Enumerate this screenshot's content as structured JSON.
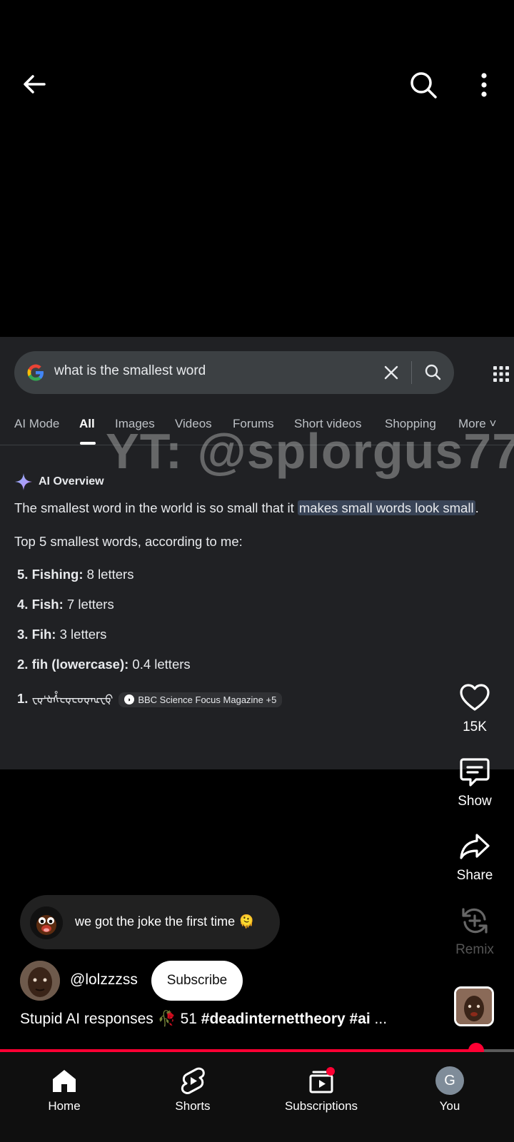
{
  "top_bar": {
    "back_icon": "arrow-left-icon",
    "search_icon": "search-icon",
    "more_icon": "more-vert-icon"
  },
  "video": {
    "google": {
      "query": "what is the smallest word",
      "tabs": [
        "AI Mode",
        "All",
        "Images",
        "Videos",
        "Forums",
        "Short videos",
        "Shopping",
        "More"
      ],
      "active_tab": "All"
    },
    "watermark": "YT: @splorgus77",
    "ai_overview": {
      "label": "AI Overview",
      "text_before": "The smallest word in the world is so small that it ",
      "text_highlight": "makes small words look small",
      "text_after": ".",
      "subtitle": "Top 5 smallest words, according to me:",
      "items": [
        {
          "num": "5. Fishing:",
          "value": " 8 letters"
        },
        {
          "num": "4. Fish:",
          "value": " 7 letters"
        },
        {
          "num": "3. Fih:",
          "value": " 3 letters"
        },
        {
          "num": "2. fih (lowercase):",
          "value": " 0.4 letters"
        },
        {
          "num": "1.",
          "value": ""
        }
      ],
      "tiny_word": "ᠸᡇᡃᡈᢥᡄᡇᡄᡉᡇᡅᠸᡇ",
      "source": "BBC Science Focus Magazine +5"
    }
  },
  "actions": {
    "like_count": "15K",
    "comments_label": "Show",
    "share_label": "Share",
    "remix_label": "Remix"
  },
  "comment": {
    "text": "we got the joke the first time 🫠"
  },
  "channel": {
    "handle": "@lolzzzss",
    "subscribe_label": "Subscribe"
  },
  "caption": {
    "text": "Stupid AI responses 🥀 51 ",
    "tags": "#deadinternettheory #ai",
    "ellipsis": " ..."
  },
  "progress": {
    "percent": 92
  },
  "nav": {
    "items": [
      {
        "label": "Home",
        "icon": "home-icon"
      },
      {
        "label": "Shorts",
        "icon": "shorts-icon"
      },
      {
        "label": "Subscriptions",
        "icon": "subscriptions-icon"
      },
      {
        "label": "You",
        "icon": "avatar"
      }
    ],
    "you_initial": "G"
  },
  "colors": {
    "accent_red": "#ff0033",
    "highlight": "#394457"
  }
}
